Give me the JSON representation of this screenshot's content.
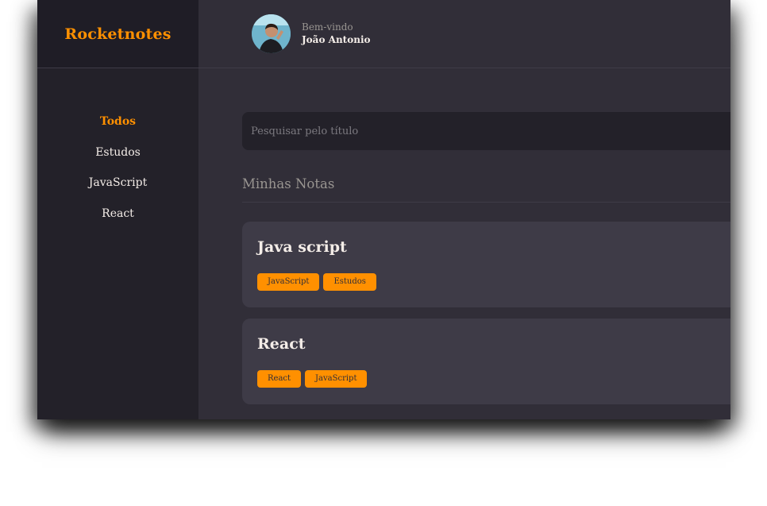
{
  "brand": {
    "name": "Rocketnotes"
  },
  "header": {
    "greeting": "Bem-vindo",
    "user_name": "João Antonio"
  },
  "menu": {
    "items": [
      {
        "label": "Todos",
        "active": true
      },
      {
        "label": "Estudos",
        "active": false
      },
      {
        "label": "JavaScript",
        "active": false
      },
      {
        "label": "React",
        "active": false
      }
    ]
  },
  "search": {
    "placeholder": "Pesquisar pelo título",
    "value": ""
  },
  "notes_section": {
    "title": "Minhas Notas"
  },
  "notes": [
    {
      "title": "Java script",
      "tags": [
        "JavaScript",
        "Estudos"
      ]
    },
    {
      "title": "React",
      "tags": [
        "React",
        "JavaScript"
      ]
    }
  ],
  "colors": {
    "accent": "#ff9000",
    "background": "#312e38",
    "sidebar": "#232129",
    "card": "#3e3b47",
    "text": "#f4ede8",
    "muted": "#999591"
  },
  "icons": {
    "avatar": "user-avatar-photo"
  }
}
